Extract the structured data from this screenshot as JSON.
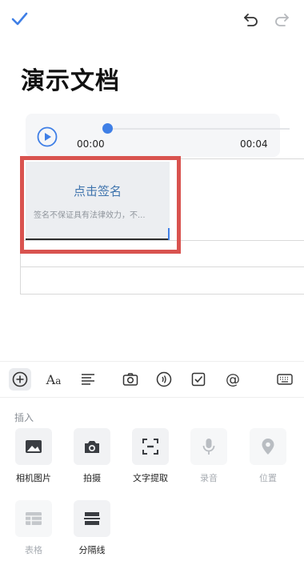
{
  "document": {
    "title": "演示文档"
  },
  "audio": {
    "current_time": "00:00",
    "duration": "00:04",
    "progress": 0
  },
  "signature": {
    "prompt": "点击签名",
    "note": "签名不保证具有法律效力，不..."
  },
  "colors": {
    "accent": "#3f7fe6",
    "highlight_border": "#d9534f",
    "signature_prompt": "#3f74ad"
  },
  "toolbar": {
    "icons": [
      "plus-circle-icon",
      "font-icon",
      "align-icon",
      "camera-icon",
      "voice-icon",
      "checkbox-icon",
      "mention-icon",
      "keyboard-icon"
    ]
  },
  "insert_panel": {
    "section_label": "插入",
    "items": [
      {
        "label": "相机图片",
        "icon": "image-icon",
        "enabled": true
      },
      {
        "label": "拍摄",
        "icon": "camera-icon",
        "enabled": true
      },
      {
        "label": "文字提取",
        "icon": "text-extract-icon",
        "enabled": true
      },
      {
        "label": "录音",
        "icon": "microphone-icon",
        "enabled": false
      },
      {
        "label": "位置",
        "icon": "location-pin-icon",
        "enabled": false
      },
      {
        "label": "表格",
        "icon": "table-icon",
        "enabled": false
      },
      {
        "label": "分隔线",
        "icon": "divider-icon",
        "enabled": true
      }
    ]
  }
}
